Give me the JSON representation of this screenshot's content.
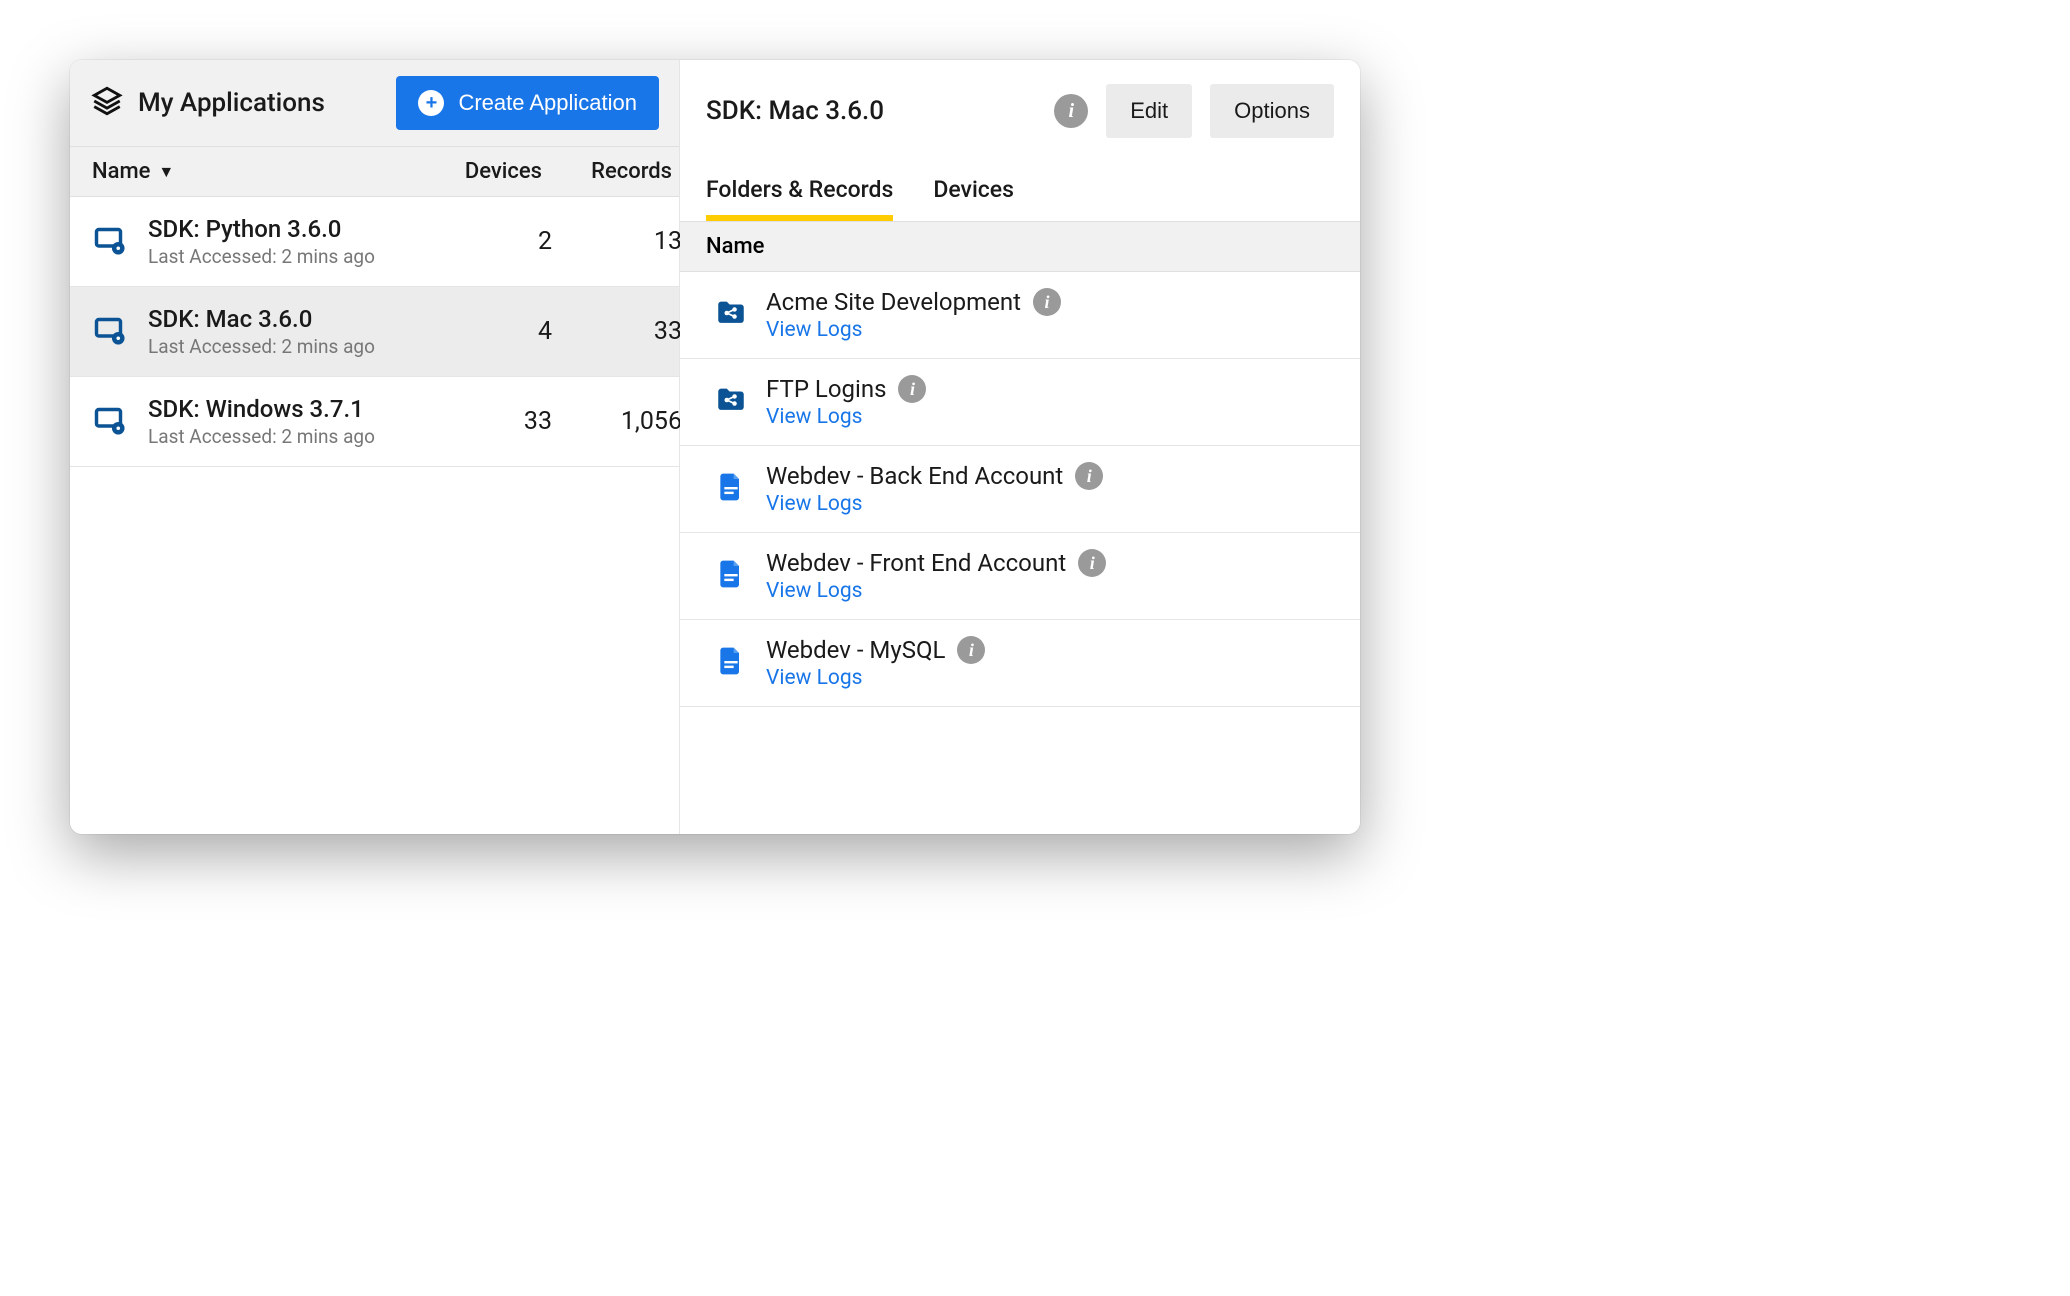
{
  "left": {
    "title": "My Applications",
    "create_label": "Create Application",
    "columns": {
      "name": "Name",
      "devices": "Devices",
      "records": "Records"
    },
    "apps": [
      {
        "title": "SDK: Python 3.6.0",
        "sub": "Last Accessed: 2 mins ago",
        "devices": "2",
        "records": "13"
      },
      {
        "title": "SDK: Mac 3.6.0",
        "sub": "Last Accessed: 2 mins ago",
        "devices": "4",
        "records": "33"
      },
      {
        "title": "SDK: Windows 3.7.1",
        "sub": "Last Accessed: 2 mins ago",
        "devices": "33",
        "records": "1,056"
      }
    ]
  },
  "right": {
    "title": "SDK: Mac 3.6.0",
    "edit_label": "Edit",
    "options_label": "Options",
    "tabs": {
      "folders": "Folders & Records",
      "devices": "Devices"
    },
    "column_name": "Name",
    "view_logs": "View Logs",
    "records": [
      {
        "name": "Acme Site Development",
        "type": "folder"
      },
      {
        "name": "FTP Logins",
        "type": "folder"
      },
      {
        "name": "Webdev - Back End Account",
        "type": "file"
      },
      {
        "name": "Webdev - Front End Account",
        "type": "file"
      },
      {
        "name": "Webdev - MySQL",
        "type": "file"
      }
    ]
  }
}
